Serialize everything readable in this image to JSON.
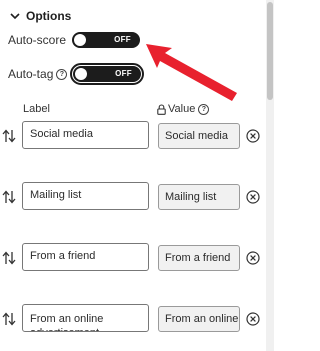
{
  "section": {
    "title": "Options",
    "chevron_icon": "chevron-down-icon"
  },
  "auto_score": {
    "label": "Auto-score",
    "toggle_text": "OFF"
  },
  "auto_tag": {
    "label": "Auto-tag",
    "help_glyph": "?",
    "toggle_text": "OFF"
  },
  "columns": {
    "label_header": "Label",
    "value_header": "Value",
    "value_help_glyph": "?",
    "lock_icon": "lock-icon"
  },
  "options": [
    {
      "label": "Social media",
      "value": "Social media"
    },
    {
      "label": "Mailing list",
      "value": "Mailing list"
    },
    {
      "label": "From a friend",
      "value": "From a friend"
    },
    {
      "label": "From an online advertisement",
      "value": "From an online advertisement"
    }
  ],
  "colors": {
    "annotation_arrow": "#e8212e",
    "toggle_bg": "#1c1c1c"
  }
}
